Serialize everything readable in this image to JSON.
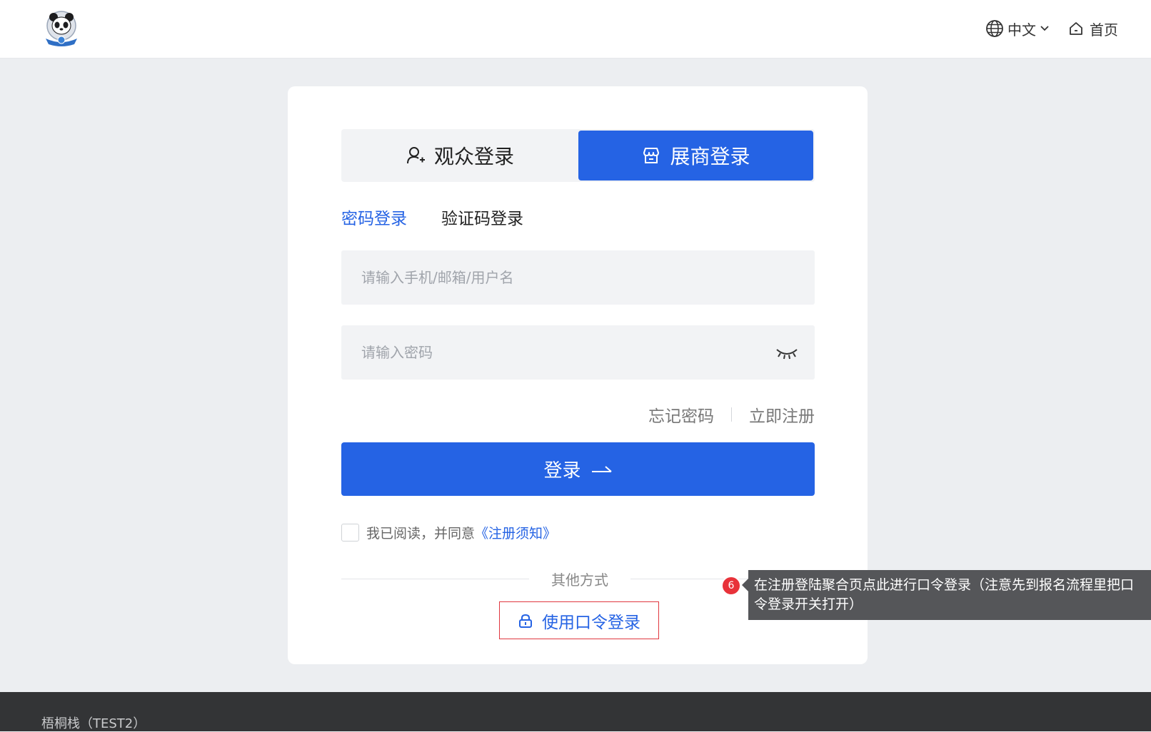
{
  "header": {
    "logo": "panda-logo",
    "language_label": "中文",
    "home_label": "首页"
  },
  "login": {
    "role_tabs": [
      {
        "label": "观众登录",
        "icon": "user-add-icon",
        "active": false
      },
      {
        "label": "展商登录",
        "icon": "store-icon",
        "active": true
      }
    ],
    "mode_tabs": [
      {
        "label": "密码登录",
        "active": true
      },
      {
        "label": "验证码登录",
        "active": false
      }
    ],
    "account_placeholder": "请输入手机/邮箱/用户名",
    "password_placeholder": "请输入密码",
    "forgot_password": "忘记密码",
    "register": "立即注册",
    "submit_label": "登录",
    "agreement_text": "我已阅读，并同意",
    "agreement_link": "《注册须知》",
    "other_methods": "其他方式",
    "token_login": "使用口令登录"
  },
  "annotation": {
    "badge": "6",
    "text": "在注册登陆聚合页点此进行口令登录（注意先到报名流程里把口令登录开关打开）"
  },
  "footer": {
    "copyright": "梧桐栈（TEST2）"
  },
  "colors": {
    "primary": "#2563e4",
    "background": "#eceef1",
    "badge": "#e8323a",
    "tooltip": "#555659",
    "footer": "#333436",
    "highlight_border": "#e0373f"
  }
}
